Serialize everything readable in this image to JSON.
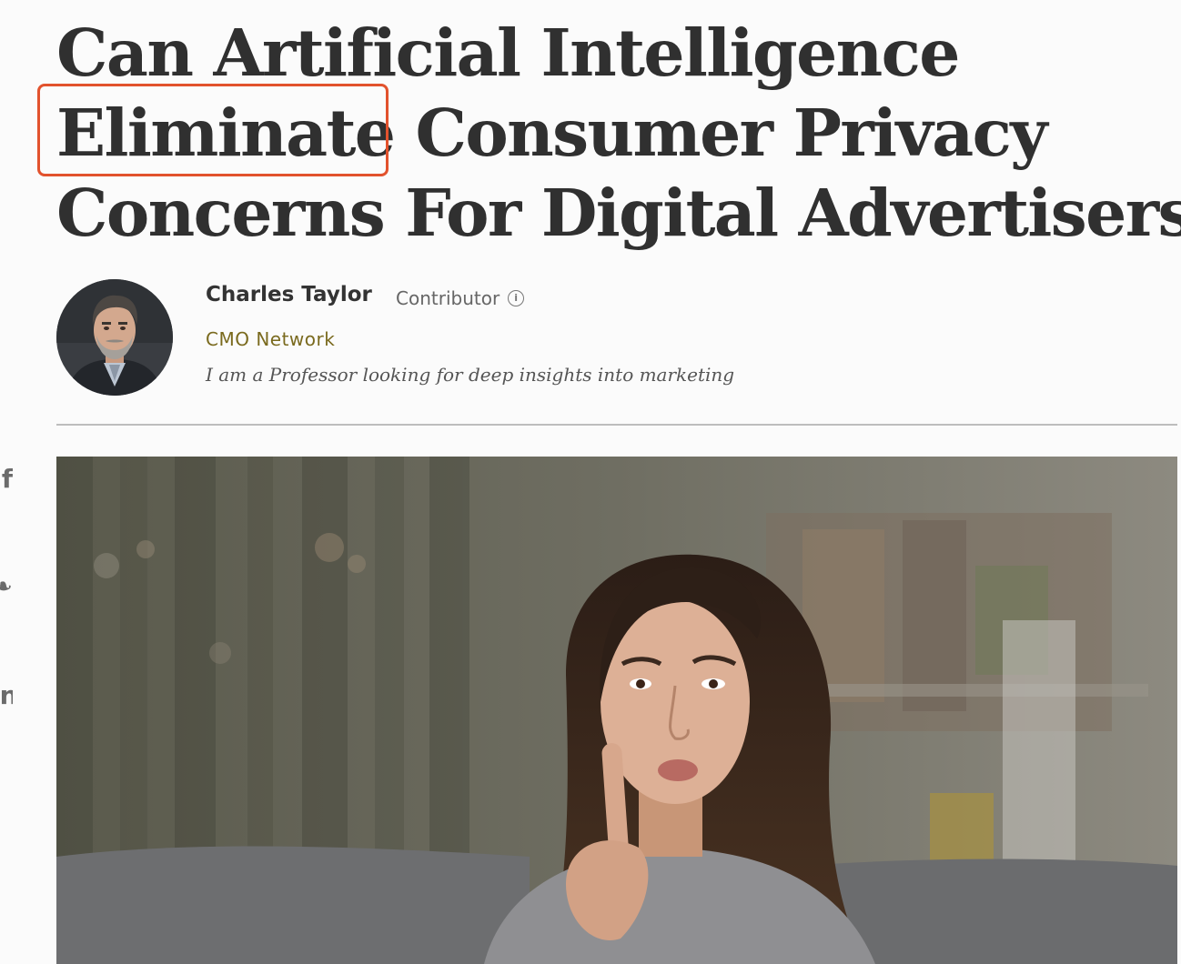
{
  "article": {
    "headline_lines": [
      "Can Artificial Intelligence",
      "Eliminate Consumer Privacy",
      "Concerns For Digital Advertisers?"
    ],
    "highlighted_word": "Eliminate"
  },
  "author": {
    "name": "Charles Taylor",
    "role": "Contributor",
    "network": "CMO Network",
    "bio": "I am a Professor looking for deep insights into marketing"
  },
  "icons": {
    "info": "info-icon",
    "avatar": "author-avatar-photo",
    "hero": "woman-finger-on-lips-photo"
  },
  "share": {
    "facebook_glyph": "f",
    "twitter_glyph": "❧",
    "linkedin_glyph": "in"
  },
  "colors": {
    "highlight_border": "#e2522d",
    "network_text": "#7a6a1e",
    "headline_text": "#303030"
  }
}
